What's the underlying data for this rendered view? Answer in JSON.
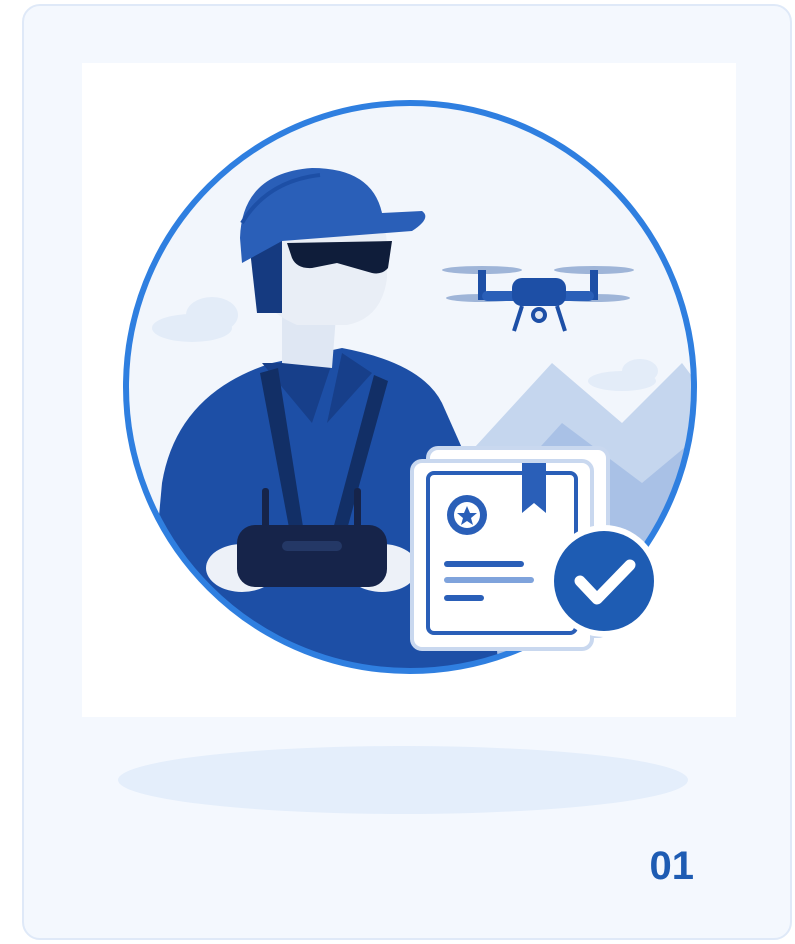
{
  "card": {
    "step_number": "01",
    "background_color": "#f4f8fe",
    "border_color": "#dfe9f8",
    "accent_color": "#1e5cb3"
  },
  "illustration": {
    "subject": "drone-pilot-certification",
    "icons": [
      "drone-icon",
      "certificate-icon",
      "check-badge-icon",
      "remote-controller-icon",
      "pilot-figure"
    ],
    "primary_color": "#1a4fa8",
    "circle_border_color": "#2f7fe0"
  }
}
